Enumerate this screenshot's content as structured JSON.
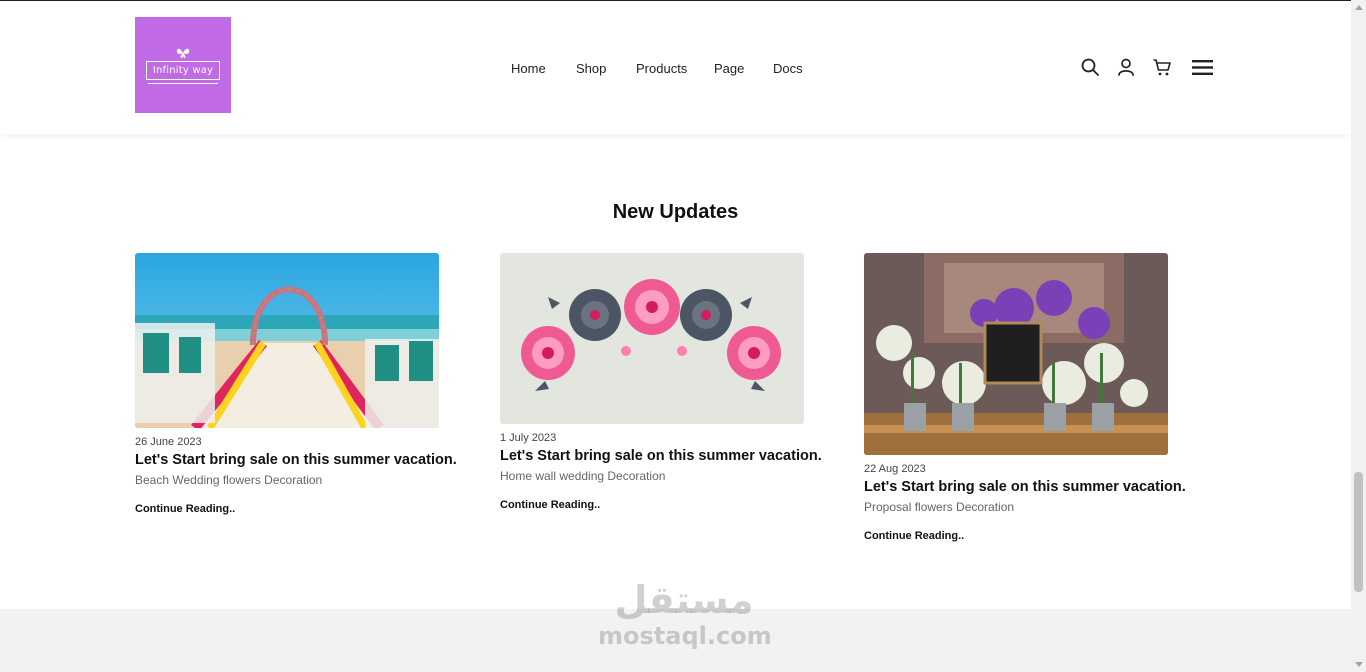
{
  "header": {
    "logo_text": "Infinity way",
    "nav": [
      "Home",
      "Shop",
      "Products",
      "Page",
      "Docs"
    ],
    "icons": [
      "search-icon",
      "user-icon",
      "cart-icon",
      "menu-icon"
    ]
  },
  "section": {
    "title": "New Updates",
    "cards": [
      {
        "date": "26 June 2023",
        "title": "Let's Start bring sale on this summer vacation.",
        "subtitle": "Beach Wedding flowers Decoration",
        "link": "Continue Reading.."
      },
      {
        "date": "1 July 2023",
        "title": "Let's Start bring sale on this summer vacation.",
        "subtitle": "Home wall wedding Decoration",
        "link": "Continue Reading.."
      },
      {
        "date": "22 Aug 2023",
        "title": "Let's Start bring sale on this summer vacation.",
        "subtitle": "Proposal flowers Decoration",
        "link": "Continue Reading.."
      }
    ]
  },
  "watermark": {
    "arabic": "مستقل",
    "latin": "mostaql.com"
  },
  "colors": {
    "logo_bg": "#c06ae6",
    "footer_bg": "#f1f2f4"
  }
}
